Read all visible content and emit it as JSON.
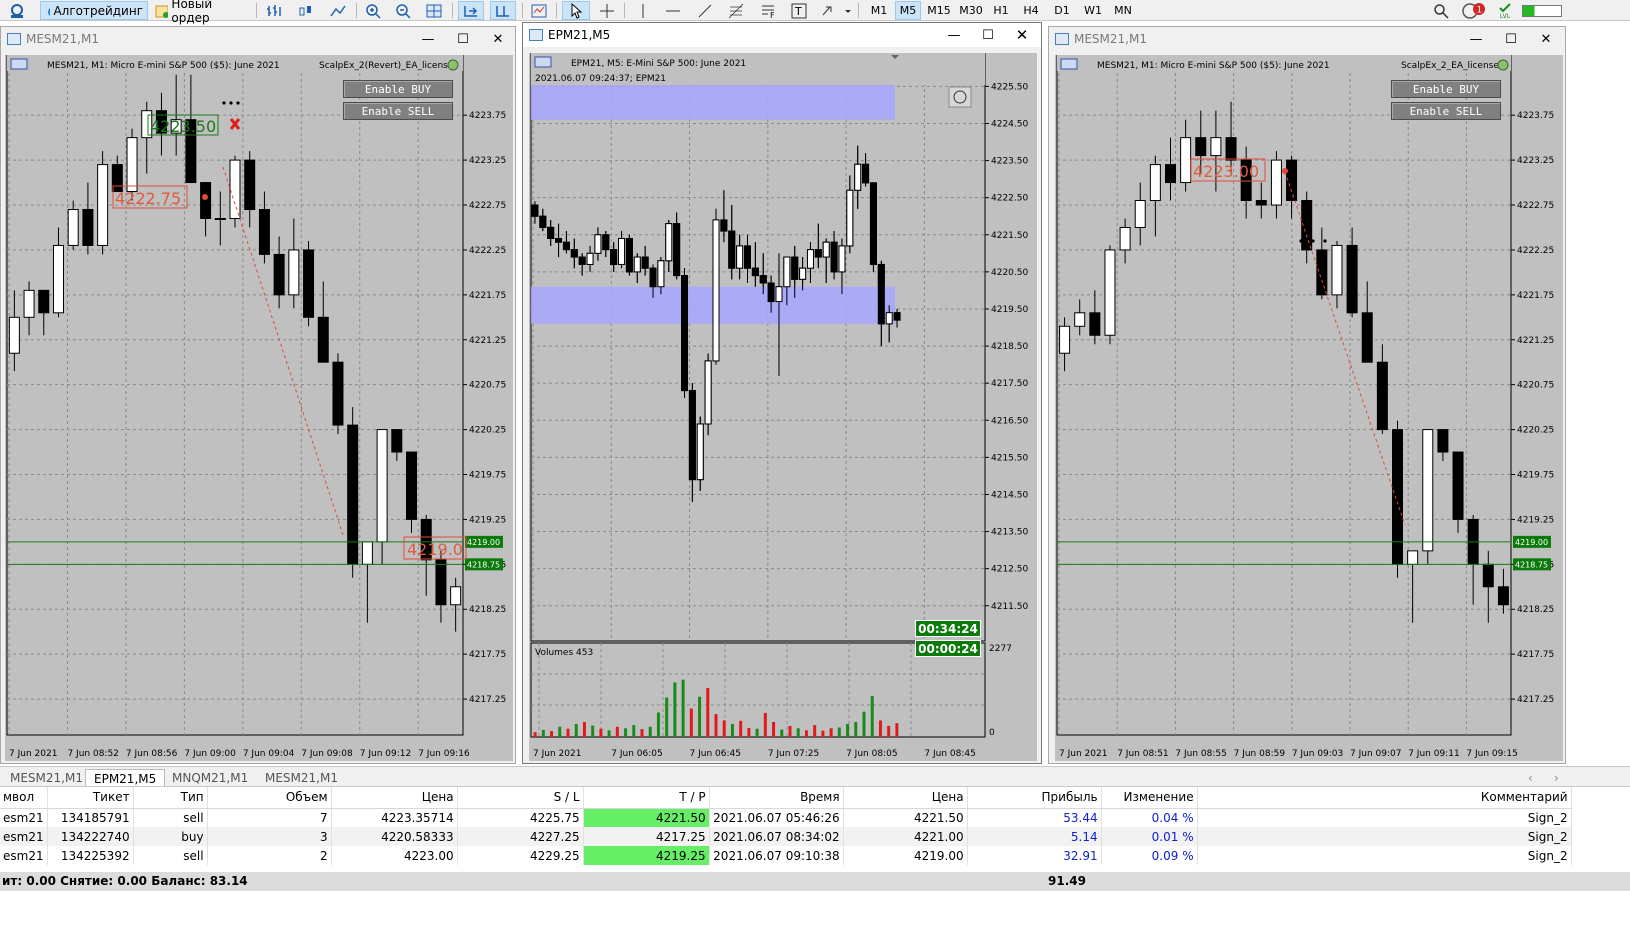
{
  "toolbar": {
    "algotrading_label": "Алготрейдинг",
    "new_order_label": "Новый ордер",
    "timeframes": [
      "M1",
      "M5",
      "M15",
      "M30",
      "H1",
      "H4",
      "D1",
      "W1",
      "MN"
    ],
    "selected_timeframe": "M5",
    "notifications_count": "1",
    "signal_label": "LVL"
  },
  "windows": [
    {
      "title": "MESM21,M1",
      "info": "MESM21, M1:  Micro E-mini S&P 500 ($5): June 2021",
      "ea_name": "ScalpEx_2(Revert)_EA_license",
      "enable_buy": "Enable BUY",
      "enable_sell": "Enable SELL",
      "y_axis": [
        "4223.75",
        "4223.25",
        "4222.75",
        "4222.25",
        "4221.75",
        "4221.25",
        "4220.75",
        "4220.25",
        "4219.75",
        "4219.25",
        "4218.75",
        "4218.25",
        "4217.75",
        "4217.25"
      ],
      "x_axis": [
        "7 Jun 2021",
        "7 Jun 08:52",
        "7 Jun 08:56",
        "7 Jun 09:00",
        "7 Jun 09:04",
        "7 Jun 09:08",
        "7 Jun 09:12",
        "7 Jun 09:16"
      ],
      "price_tags": [
        "4219.00",
        "4218.75"
      ],
      "labels": [
        "4223.50",
        "4222.75",
        "4219.0"
      ]
    },
    {
      "title": "EPM21,M5",
      "info": "EPM21, M5:  E-Mini S&P 500: June 2021",
      "info2": "2021.06.07 09:24:37; EPM21",
      "y_axis": [
        "4225.50",
        "4224.50",
        "4223.50",
        "4222.50",
        "4221.50",
        "4220.50",
        "4219.50",
        "4218.50",
        "4217.50",
        "4216.50",
        "4215.50",
        "4214.50",
        "4213.50",
        "4212.50",
        "4211.50"
      ],
      "x_axis": [
        "7 Jun 2021",
        "7 Jun 06:05",
        "7 Jun 06:45",
        "7 Jun 07:25",
        "7 Jun 08:05",
        "7 Jun 08:45"
      ],
      "timer_1": "00:34:24",
      "timer_2": "00:00:24",
      "volumes_label": "Volumes 453",
      "vol_max": "2277",
      "vol_min": "0"
    },
    {
      "title": "MESM21,M1",
      "info": "MESM21, M1:  Micro E-mini S&P 500 ($5): June 2021",
      "ea_name": "ScalpEx_2_EA_license",
      "enable_buy": "Enable BUY",
      "enable_sell": "Enable SELL",
      "y_axis": [
        "4223.75",
        "4223.25",
        "4222.75",
        "4222.25",
        "4221.75",
        "4221.25",
        "4220.75",
        "4220.25",
        "4219.75",
        "4219.25",
        "4218.75",
        "4218.25",
        "4217.75",
        "4217.25"
      ],
      "x_axis": [
        "7 Jun 2021",
        "7 Jun 08:51",
        "7 Jun 08:55",
        "7 Jun 08:59",
        "7 Jun 09:03",
        "7 Jun 09:07",
        "7 Jun 09:11",
        "7 Jun 09:15"
      ],
      "price_tags": [
        "4219.00",
        "4218.75"
      ],
      "labels": [
        "4223.00"
      ]
    }
  ],
  "tabs": [
    "MESM21,M1",
    "EPM21,M5",
    "MNQM21,M1",
    "MESM21,M1"
  ],
  "selected_tab": "EPM21,M5",
  "terminal": {
    "columns": [
      "мвол",
      "Тикет",
      "Тип",
      "Объем",
      "Цена",
      "S / L",
      "T / P",
      "Время",
      "Цена",
      "Прибыль",
      "Изменение",
      "Комментарий"
    ],
    "rows": [
      [
        "esm21",
        "134185791",
        "sell",
        "7",
        "4223.35714",
        "4225.75",
        "4221.50",
        "2021.06.07 05:46:26",
        "4221.50",
        "53.44",
        "0.04 %",
        "Sign_2"
      ],
      [
        "esm21",
        "134222740",
        "buy",
        "3",
        "4220.58333",
        "4227.25",
        "4217.25",
        "2021.06.07 08:34:02",
        "4221.00",
        "5.14",
        "0.01 %",
        "Sign_2"
      ],
      [
        "esm21",
        "134225392",
        "sell",
        "2",
        "4223.00",
        "4229.25",
        "4219.25",
        "2021.06.07 09:10:38",
        "4219.00",
        "32.91",
        "0.09 %",
        "Sign_2"
      ]
    ],
    "summary": "ит: 0.00  Снятие: 0.00  Баланс: 83.14",
    "total_profit": "91.49"
  },
  "colors": {
    "chart_bg": "#c0c0c0",
    "bull": "#ffffff",
    "bear": "#000000",
    "tag_green": "#0a7a0a",
    "zone": "#a6a6ff",
    "tp_bg": "#66ee66"
  },
  "candles": {
    "w1": [
      [
        4221.1,
        4221.8,
        4220.9,
        4221.5
      ],
      [
        4221.5,
        4221.9,
        4221.3,
        4221.8
      ],
      [
        4221.8,
        4221.8,
        4221.3,
        4221.55
      ],
      [
        4221.55,
        4222.5,
        4221.5,
        4222.3
      ],
      [
        4222.3,
        4222.8,
        4222.25,
        4222.7
      ],
      [
        4222.7,
        4223.0,
        4222.2,
        4222.3
      ],
      [
        4222.3,
        4223.35,
        4222.2,
        4223.2
      ],
      [
        4223.2,
        4223.3,
        4222.9,
        4222.9
      ],
      [
        4222.9,
        4223.6,
        4222.8,
        4223.5
      ],
      [
        4223.5,
        4223.9,
        4223.1,
        4223.8
      ],
      [
        4223.8,
        4224.0,
        4223.3,
        4223.55
      ],
      [
        4223.55,
        4224.2,
        4223.3,
        4223.7
      ],
      [
        4223.7,
        4224.2,
        4223.0,
        4223.0
      ],
      [
        4223.0,
        4223.0,
        4222.4,
        4222.6
      ],
      [
        4222.6,
        4222.9,
        4222.3,
        4222.6
      ],
      [
        4222.6,
        4223.3,
        4222.5,
        4223.25
      ],
      [
        4223.25,
        4223.35,
        4222.5,
        4222.7
      ],
      [
        4222.7,
        4222.9,
        4222.1,
        4222.2
      ],
      [
        4222.2,
        4222.4,
        4221.6,
        4221.75
      ],
      [
        4221.75,
        4222.6,
        4221.6,
        4222.25
      ],
      [
        4222.25,
        4222.35,
        4221.4,
        4221.5
      ],
      [
        4221.5,
        4221.9,
        4221.0,
        4221.0
      ],
      [
        4221.0,
        4221.1,
        4220.2,
        4220.3
      ],
      [
        4220.3,
        4220.5,
        4218.6,
        4218.75
      ],
      [
        4218.75,
        4219.0,
        4218.1,
        4219.0
      ],
      [
        4219.0,
        4220.25,
        4218.75,
        4220.25
      ],
      [
        4220.25,
        4220.25,
        4219.9,
        4220.0
      ],
      [
        4220.0,
        4220.0,
        4219.1,
        4219.25
      ],
      [
        4219.25,
        4219.3,
        4218.4,
        4218.8
      ],
      [
        4218.8,
        4218.9,
        4218.1,
        4218.3
      ],
      [
        4218.3,
        4218.6,
        4218.0,
        4218.5
      ]
    ],
    "w2": [
      [
        4222.3,
        4222.4,
        4221.8,
        4222.0
      ],
      [
        4222.0,
        4222.2,
        4221.6,
        4221.7
      ],
      [
        4221.7,
        4221.9,
        4221.2,
        4221.4
      ],
      [
        4221.4,
        4221.8,
        4220.9,
        4221.3
      ],
      [
        4221.3,
        4221.6,
        4221.0,
        4221.1
      ],
      [
        4221.1,
        4221.4,
        4220.6,
        4220.9
      ],
      [
        4220.9,
        4221.0,
        4220.4,
        4220.7
      ],
      [
        4220.7,
        4221.2,
        4220.5,
        4221.0
      ],
      [
        4221.0,
        4221.7,
        4220.8,
        4221.5
      ],
      [
        4221.5,
        4221.6,
        4220.9,
        4221.1
      ],
      [
        4221.1,
        4221.3,
        4220.5,
        4220.7
      ],
      [
        4220.7,
        4221.6,
        4220.6,
        4221.4
      ],
      [
        4221.4,
        4221.5,
        4220.4,
        4220.5
      ],
      [
        4220.5,
        4221.0,
        4220.2,
        4220.9
      ],
      [
        4220.9,
        4221.2,
        4220.4,
        4220.6
      ],
      [
        4220.6,
        4220.7,
        4219.8,
        4220.1
      ],
      [
        4220.1,
        4220.9,
        4219.9,
        4220.8
      ],
      [
        4220.8,
        4221.9,
        4220.5,
        4221.8
      ],
      [
        4221.8,
        4222.1,
        4220.3,
        4220.4
      ],
      [
        4220.4,
        4220.6,
        4217.1,
        4217.3
      ],
      [
        4217.3,
        4217.5,
        4214.3,
        4214.9
      ],
      [
        4214.9,
        4216.6,
        4214.6,
        4216.4
      ],
      [
        4216.4,
        4218.3,
        4216.1,
        4218.1
      ],
      [
        4218.1,
        4222.2,
        4218.0,
        4221.9
      ],
      [
        4221.9,
        4222.7,
        4221.3,
        4221.6
      ],
      [
        4221.6,
        4222.3,
        4220.3,
        4220.6
      ],
      [
        4220.6,
        4221.5,
        4220.3,
        4221.2
      ],
      [
        4221.2,
        4221.5,
        4220.2,
        4220.6
      ],
      [
        4220.6,
        4221.3,
        4220.1,
        4220.4
      ],
      [
        4220.4,
        4221.0,
        4219.9,
        4220.2
      ],
      [
        4220.2,
        4220.4,
        4219.4,
        4219.7
      ],
      [
        4219.7,
        4221.0,
        4217.7,
        4220.1
      ],
      [
        4220.1,
        4220.8,
        4219.6,
        4220.9
      ],
      [
        4220.9,
        4221.2,
        4219.8,
        4220.3
      ],
      [
        4220.3,
        4220.9,
        4220.0,
        4220.6
      ],
      [
        4220.6,
        4221.3,
        4220.2,
        4221.1
      ],
      [
        4221.1,
        4221.8,
        4220.6,
        4220.9
      ],
      [
        4220.9,
        4221.4,
        4220.2,
        4221.3
      ],
      [
        4221.3,
        4221.6,
        4220.3,
        4220.5
      ],
      [
        4220.5,
        4221.4,
        4219.9,
        4221.2
      ],
      [
        4221.2,
        4223.1,
        4221.0,
        4222.7
      ],
      [
        4222.7,
        4223.9,
        4222.2,
        4223.4
      ],
      [
        4223.4,
        4223.7,
        4222.8,
        4222.9
      ],
      [
        4222.9,
        4222.9,
        4220.5,
        4220.7
      ],
      [
        4220.7,
        4220.8,
        4218.5,
        4219.1
      ],
      [
        4219.1,
        4219.6,
        4218.6,
        4219.4
      ],
      [
        4219.4,
        4219.5,
        4219.0,
        4219.2
      ]
    ],
    "w3": [
      [
        4221.1,
        4221.5,
        4220.9,
        4221.4
      ],
      [
        4221.4,
        4221.7,
        4221.3,
        4221.55
      ],
      [
        4221.55,
        4221.8,
        4221.2,
        4221.3
      ],
      [
        4221.3,
        4222.3,
        4221.2,
        4222.25
      ],
      [
        4222.25,
        4222.6,
        4222.1,
        4222.5
      ],
      [
        4222.5,
        4223.0,
        4222.3,
        4222.8
      ],
      [
        4222.8,
        4223.3,
        4222.4,
        4223.2
      ],
      [
        4223.2,
        4223.5,
        4222.8,
        4223.0
      ],
      [
        4223.0,
        4223.7,
        4222.9,
        4223.5
      ],
      [
        4223.5,
        4223.8,
        4223.1,
        4223.3
      ],
      [
        4223.3,
        4223.8,
        4222.9,
        4223.5
      ],
      [
        4223.5,
        4223.9,
        4223.1,
        4223.25
      ],
      [
        4223.25,
        4223.4,
        4222.6,
        4222.8
      ],
      [
        4222.8,
        4223.0,
        4222.6,
        4222.75
      ],
      [
        4222.75,
        4223.35,
        4222.6,
        4223.25
      ],
      [
        4223.25,
        4223.3,
        4222.6,
        4222.8
      ],
      [
        4222.8,
        4222.9,
        4222.1,
        4222.25
      ],
      [
        4222.25,
        4222.5,
        4221.7,
        4221.75
      ],
      [
        4221.75,
        4222.35,
        4221.6,
        4222.3
      ],
      [
        4222.3,
        4222.5,
        4221.5,
        4221.55
      ],
      [
        4221.55,
        4221.9,
        4221.0,
        4221.0
      ],
      [
        4221.0,
        4221.2,
        4220.2,
        4220.25
      ],
      [
        4220.25,
        4220.35,
        4218.6,
        4218.75
      ],
      [
        4218.75,
        4218.9,
        4218.1,
        4218.9
      ],
      [
        4218.9,
        4220.25,
        4218.75,
        4220.25
      ],
      [
        4220.25,
        4220.25,
        4219.9,
        4220.0
      ],
      [
        4220.0,
        4220.0,
        4219.1,
        4219.25
      ],
      [
        4219.25,
        4219.3,
        4218.3,
        4218.75
      ],
      [
        4218.75,
        4218.9,
        4218.1,
        4218.5
      ],
      [
        4218.5,
        4218.7,
        4218.2,
        4218.3
      ]
    ],
    "vols": [
      [
        120,
        "r"
      ],
      [
        180,
        "g"
      ],
      [
        150,
        "r"
      ],
      [
        260,
        "g"
      ],
      [
        210,
        "r"
      ],
      [
        330,
        "g"
      ],
      [
        380,
        "r"
      ],
      [
        290,
        "g"
      ],
      [
        210,
        "r"
      ],
      [
        170,
        "g"
      ],
      [
        260,
        "r"
      ],
      [
        220,
        "g"
      ],
      [
        300,
        "g"
      ],
      [
        200,
        "r"
      ],
      [
        260,
        "g"
      ],
      [
        620,
        "g"
      ],
      [
        1000,
        "g"
      ],
      [
        1380,
        "g"
      ],
      [
        1450,
        "g"
      ],
      [
        720,
        "r"
      ],
      [
        1020,
        "g"
      ],
      [
        1240,
        "r"
      ],
      [
        580,
        "r"
      ],
      [
        420,
        "r"
      ],
      [
        330,
        "g"
      ],
      [
        410,
        "r"
      ],
      [
        230,
        "r"
      ],
      [
        210,
        "g"
      ],
      [
        610,
        "r"
      ],
      [
        380,
        "r"
      ],
      [
        190,
        "g"
      ],
      [
        280,
        "r"
      ],
      [
        220,
        "g"
      ],
      [
        170,
        "r"
      ],
      [
        300,
        "r"
      ],
      [
        160,
        "r"
      ],
      [
        220,
        "r"
      ],
      [
        240,
        "g"
      ],
      [
        330,
        "g"
      ],
      [
        380,
        "g"
      ],
      [
        640,
        "g"
      ],
      [
        1040,
        "g"
      ],
      [
        420,
        "r"
      ],
      [
        280,
        "r"
      ],
      [
        350,
        "r"
      ]
    ]
  }
}
